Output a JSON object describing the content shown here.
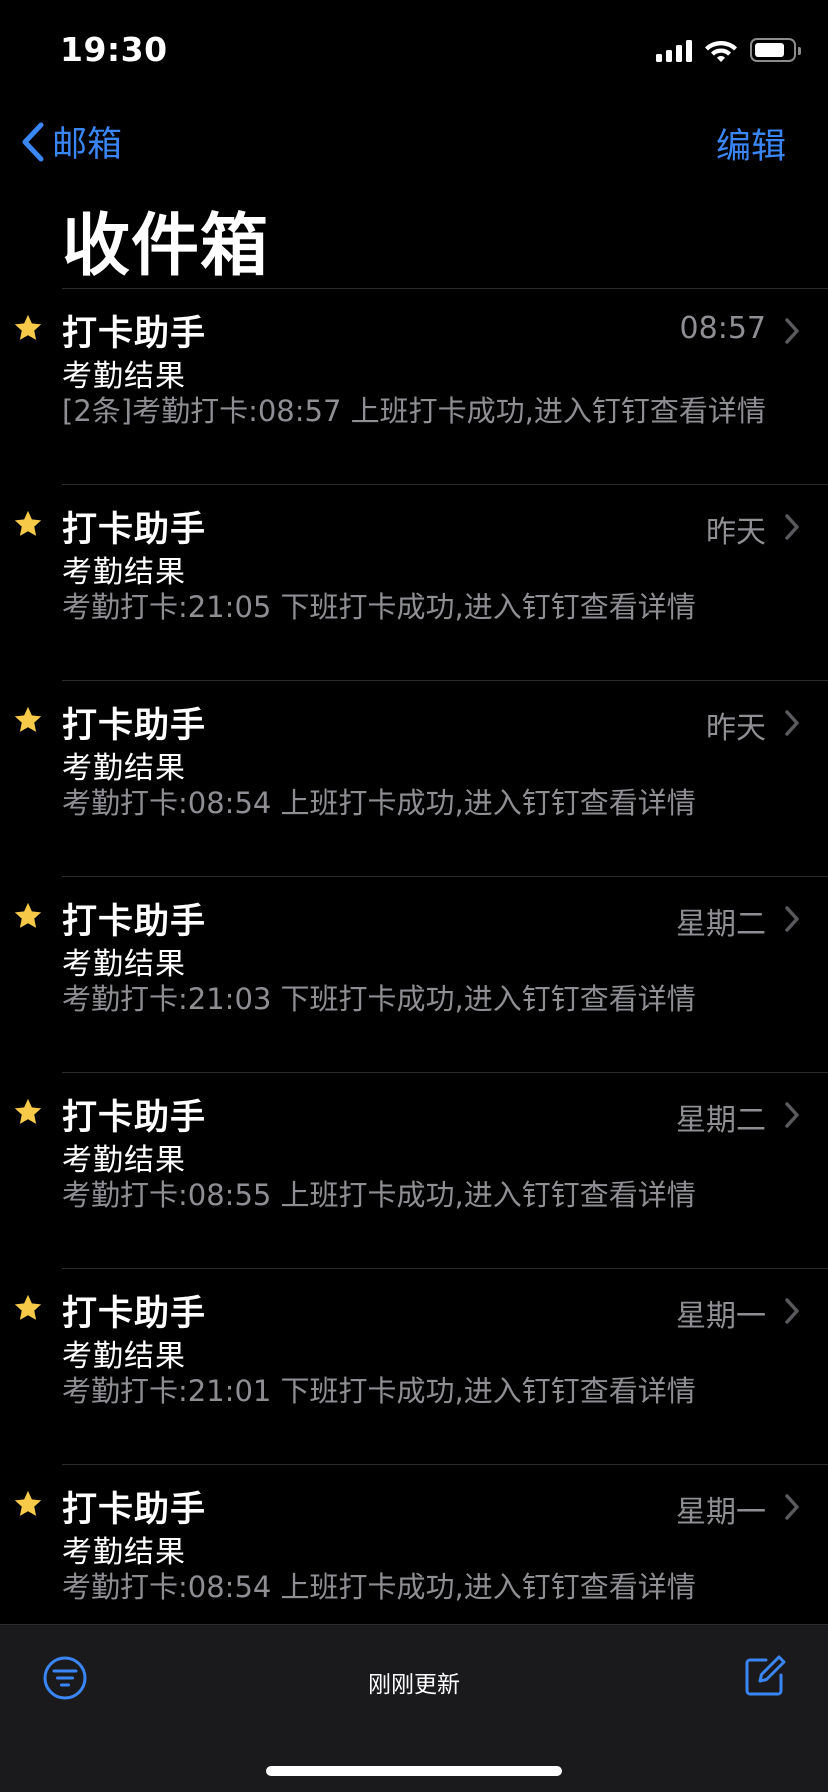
{
  "status_bar": {
    "time": "19:30",
    "battery_level": 0.8
  },
  "nav": {
    "back_label": "邮箱",
    "edit_label": "编辑",
    "title": "收件箱"
  },
  "mails": [
    {
      "sender": "打卡助手",
      "date": "08:57",
      "subject": "考勤结果",
      "preview": "[2条]考勤打卡:08:57 上班打卡成功,进入钉钉查看详情",
      "flagged": true
    },
    {
      "sender": "打卡助手",
      "date": "昨天",
      "subject": "考勤结果",
      "preview": "考勤打卡:21:05 下班打卡成功,进入钉钉查看详情",
      "flagged": true
    },
    {
      "sender": "打卡助手",
      "date": "昨天",
      "subject": "考勤结果",
      "preview": "考勤打卡:08:54 上班打卡成功,进入钉钉查看详情",
      "flagged": true
    },
    {
      "sender": "打卡助手",
      "date": "星期二",
      "subject": "考勤结果",
      "preview": "考勤打卡:21:03 下班打卡成功,进入钉钉查看详情",
      "flagged": true
    },
    {
      "sender": "打卡助手",
      "date": "星期二",
      "subject": "考勤结果",
      "preview": "考勤打卡:08:55 上班打卡成功,进入钉钉查看详情",
      "flagged": true
    },
    {
      "sender": "打卡助手",
      "date": "星期一",
      "subject": "考勤结果",
      "preview": "考勤打卡:21:01 下班打卡成功,进入钉钉查看详情",
      "flagged": true
    },
    {
      "sender": "打卡助手",
      "date": "星期一",
      "subject": "考勤结果",
      "preview": "考勤打卡:08:54 上班打卡成功,进入钉钉查看详情",
      "flagged": true
    }
  ],
  "toolbar": {
    "status_text": "刚刚更新"
  },
  "colors": {
    "accent": "#3a86f6",
    "star": "#f7c948",
    "secondary_text": "#8e8e93",
    "background": "#000000"
  },
  "icons": {
    "back": "chevron-left-icon",
    "star": "star-icon",
    "chevron": "chevron-right-icon",
    "filter": "filter-icon",
    "compose": "compose-icon"
  }
}
